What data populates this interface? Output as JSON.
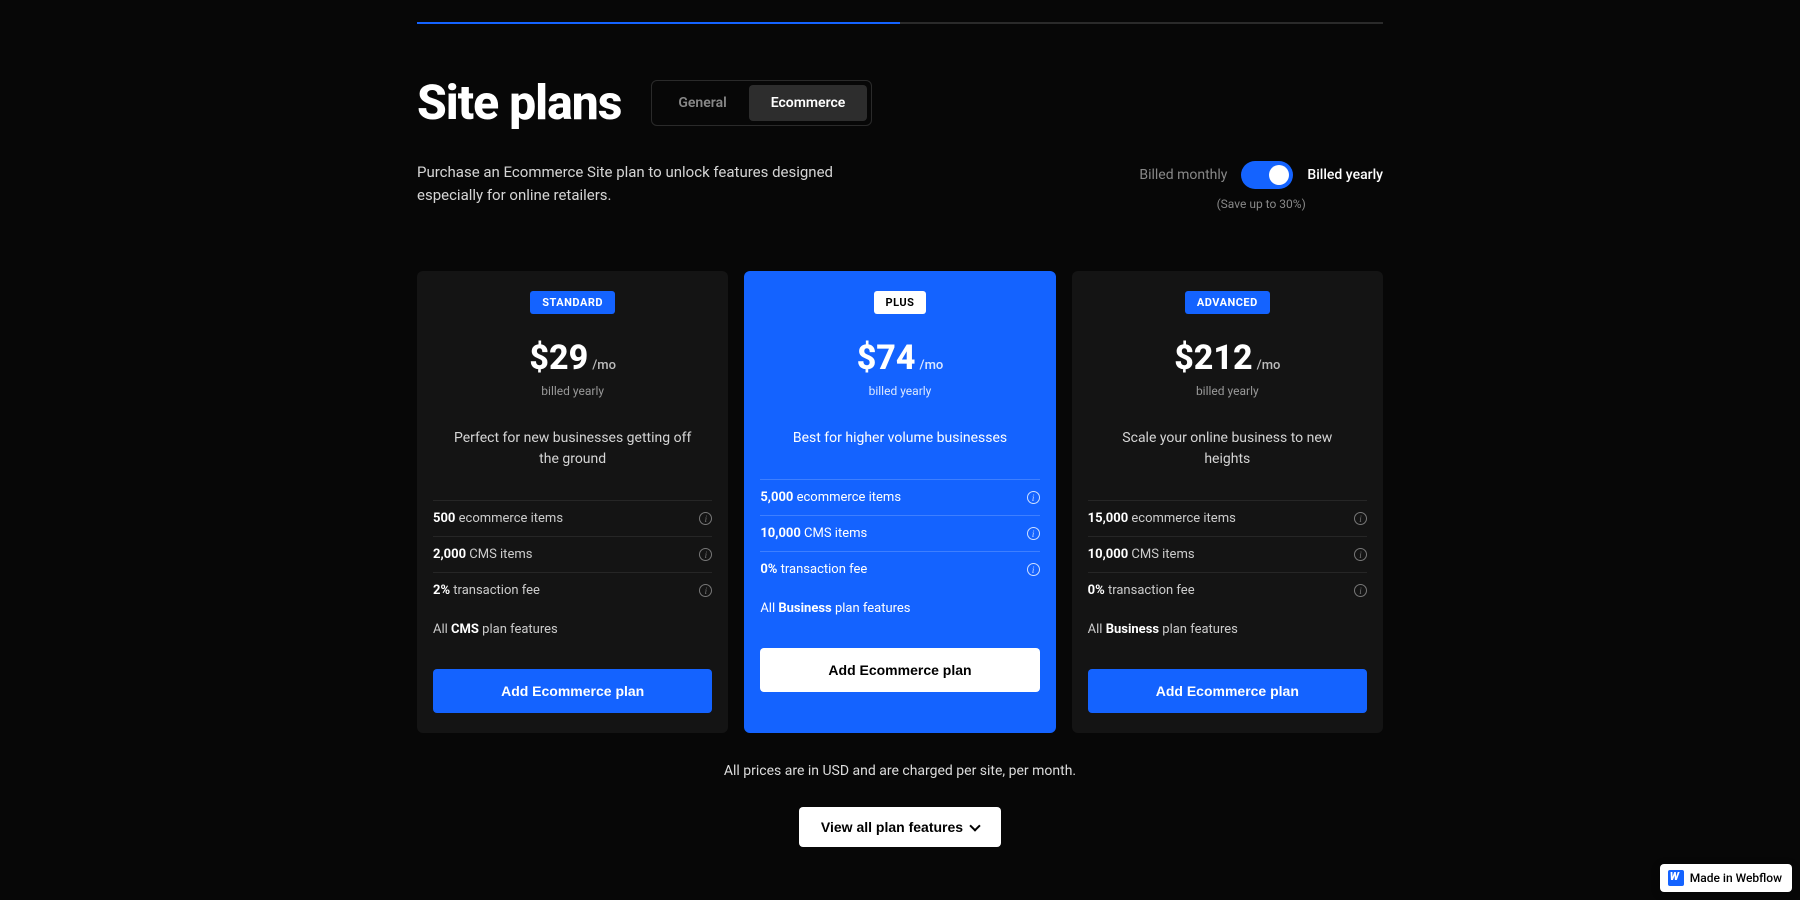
{
  "page_title": "Site plans",
  "sub_tabs": {
    "general": "General",
    "ecommerce": "Ecommerce"
  },
  "description": "Purchase an Ecommerce Site plan to unlock features designed especially for online retailers.",
  "toggle": {
    "left": "Billed monthly",
    "right": "Billed yearly",
    "save": "(Save up to 30%)"
  },
  "plans": [
    {
      "name": "STANDARD",
      "price": "$29",
      "per": "/mo",
      "billed": "billed yearly",
      "tagline": "Perfect for new businesses getting off the ground",
      "features": [
        {
          "bold": "500",
          "rest": " ecommerce items",
          "info": true
        },
        {
          "bold": "2,000",
          "rest": " CMS items",
          "info": true
        },
        {
          "bold": "2%",
          "rest": " transaction fee",
          "info": true
        },
        {
          "prefix": "All ",
          "bold": "CMS",
          "rest": " plan features",
          "info": false
        }
      ],
      "cta": "Add Ecommerce plan"
    },
    {
      "name": "PLUS",
      "price": "$74",
      "per": "/mo",
      "billed": "billed yearly",
      "tagline": "Best for higher volume businesses",
      "features": [
        {
          "bold": "5,000",
          "rest": " ecommerce items",
          "info": true
        },
        {
          "bold": "10,000",
          "rest": " CMS items",
          "info": true
        },
        {
          "bold": "0%",
          "rest": " transaction fee",
          "info": true
        },
        {
          "prefix": "All ",
          "bold": "Business",
          "rest": " plan features",
          "info": false
        }
      ],
      "cta": "Add Ecommerce plan"
    },
    {
      "name": "ADVANCED",
      "price": "$212",
      "per": "/mo",
      "billed": "billed yearly",
      "tagline": "Scale your online business to new heights",
      "features": [
        {
          "bold": "15,000",
          "rest": " ecommerce items",
          "info": true
        },
        {
          "bold": "10,000",
          "rest": " CMS items",
          "info": true
        },
        {
          "bold": "0%",
          "rest": " transaction fee",
          "info": true
        },
        {
          "prefix": "All ",
          "bold": "Business",
          "rest": " plan features",
          "info": false
        }
      ],
      "cta": "Add Ecommerce plan"
    }
  ],
  "footnote": "All prices are in USD and are charged per site, per month.",
  "view_all": "View all plan features",
  "badge": "Made in Webflow"
}
